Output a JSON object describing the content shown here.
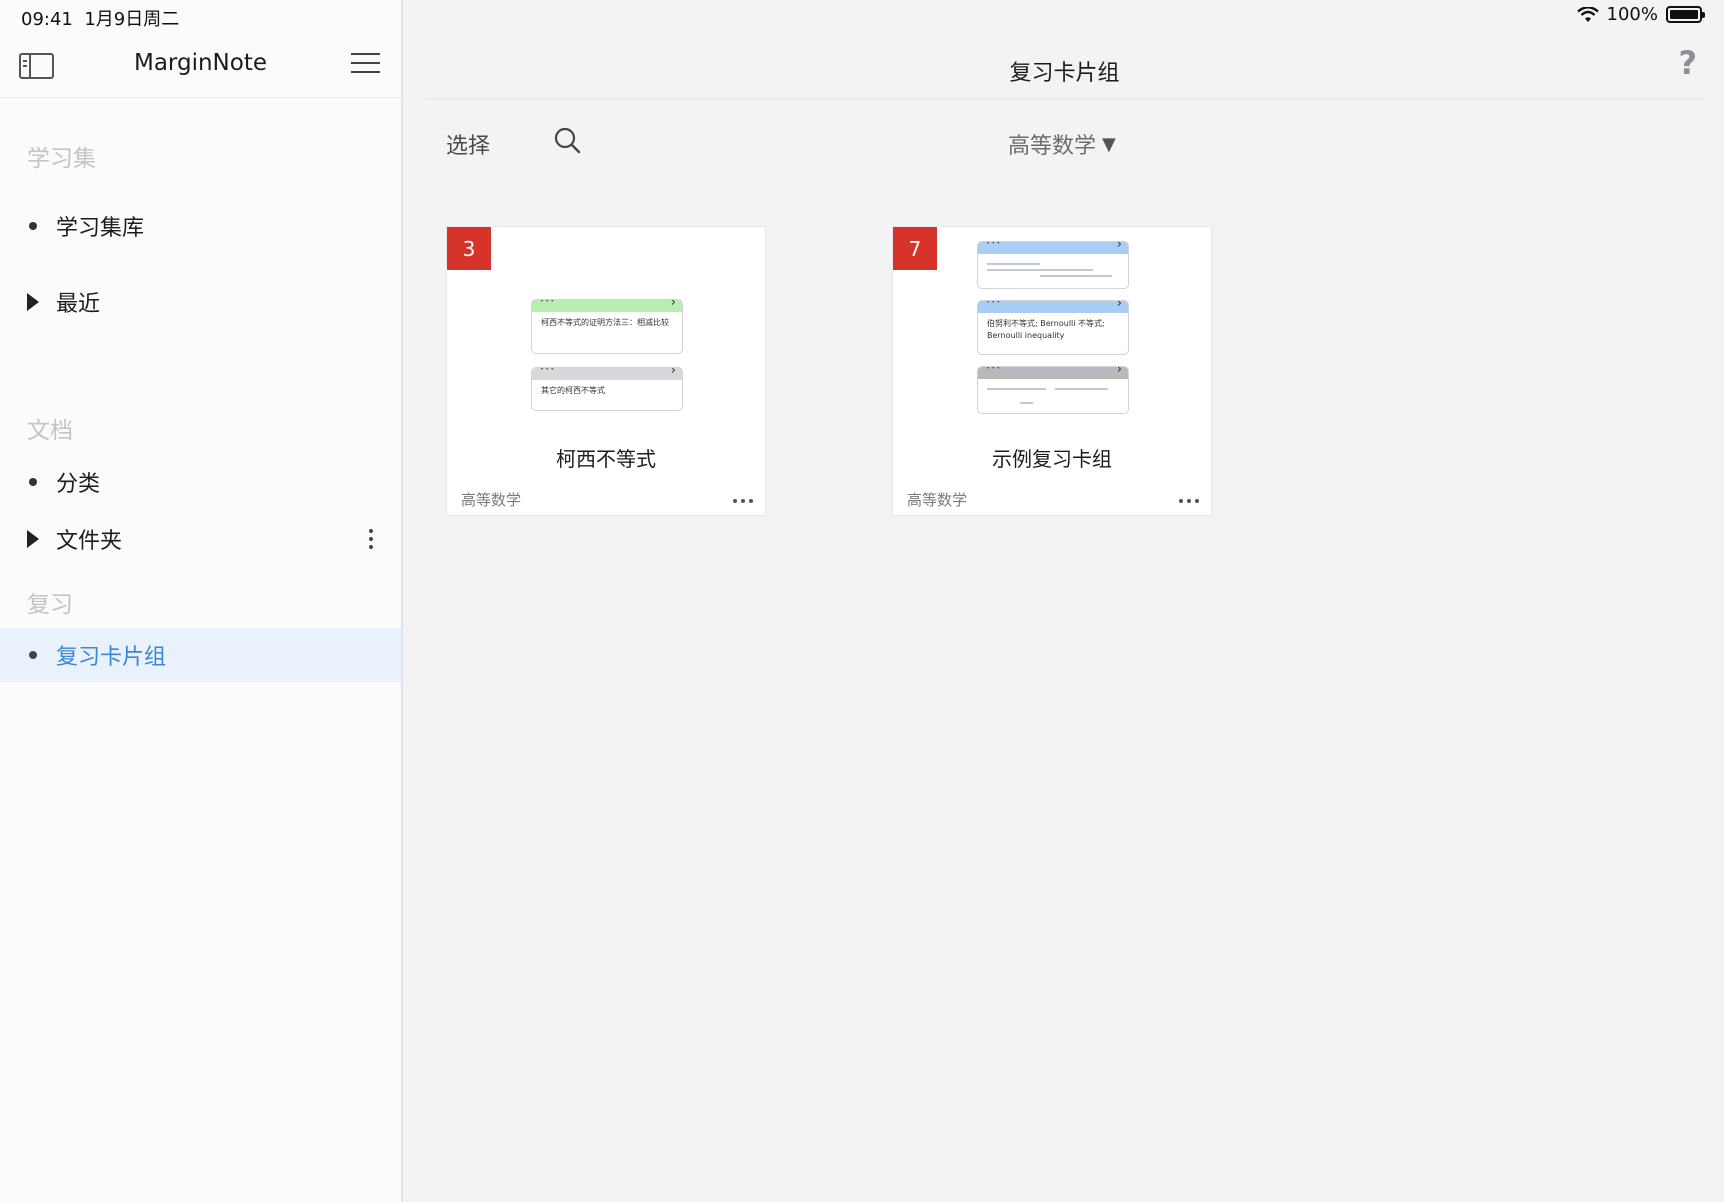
{
  "status": {
    "time": "09:41",
    "date": "1月9日周二",
    "battery": "100%"
  },
  "sidebar": {
    "app_title": "MarginNote",
    "sections": [
      {
        "title": "学习集"
      },
      {
        "title": "文档"
      },
      {
        "title": "复习"
      }
    ],
    "items": [
      {
        "label": "学习集库"
      },
      {
        "label": "最近"
      },
      {
        "label": "分类"
      },
      {
        "label": "文件夹"
      },
      {
        "label": "复习卡片组"
      }
    ]
  },
  "main": {
    "title": "复习卡片组",
    "help": "?",
    "select_label": "选择",
    "filter_label": "高等数学",
    "filter_caret": "▼"
  },
  "cards": [
    {
      "count": "3",
      "name": "柯西不等式",
      "tag": "高等数学",
      "preview": [
        {
          "text": "柯西不等式的证明方法三：相减比较",
          "header_color": "#b6efb0"
        },
        {
          "text": "其它的柯西不等式",
          "header_color": "#d8d8dc"
        }
      ]
    },
    {
      "count": "7",
      "name": "示例复习卡组",
      "tag": "高等数学",
      "preview": [
        {
          "text": "",
          "header_color": "#a9cdf5"
        },
        {
          "text": "伯努利不等式; Bernoulli 不等式; Bernoulli inequality",
          "header_color": "#a9cdf5"
        },
        {
          "text": "",
          "header_color": "#b9b9bd"
        }
      ]
    }
  ],
  "colors": {
    "accent": "#3b86d8",
    "badge": "#d6332b",
    "active_bg": "#e9f1fb"
  }
}
